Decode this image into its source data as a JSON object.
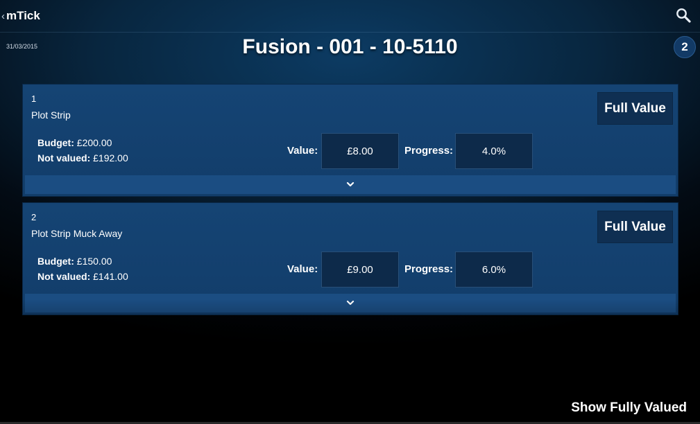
{
  "header": {
    "app_title": "mTick",
    "back_chevron": "‹",
    "date": "31/03/2015",
    "page_title": "Fusion - 001 - 10-5110",
    "badge_count": "2"
  },
  "items": [
    {
      "number": "1",
      "name": "Plot Strip",
      "budget_label": "Budget:",
      "budget_value": "£200.00",
      "not_valued_label": "Not valued:",
      "not_valued_value": "£192.00",
      "value_label": "Value:",
      "value": "£8.00",
      "progress_label": "Progress:",
      "progress": "4.0%",
      "full_value_label": "Full Value"
    },
    {
      "number": "2",
      "name": "Plot Strip Muck Away",
      "budget_label": "Budget:",
      "budget_value": "£150.00",
      "not_valued_label": "Not valued:",
      "not_valued_value": "£141.00",
      "value_label": "Value:",
      "value": "£9.00",
      "progress_label": "Progress:",
      "progress": "6.0%",
      "full_value_label": "Full Value"
    }
  ],
  "footer": {
    "show_fully_valued_label": "Show Fully Valued"
  },
  "icons": {
    "search": "search-icon",
    "expand": "chevron-down-icon"
  },
  "colors": {
    "card_background": "#154474",
    "expand_bar": "#1b4d82",
    "input_background": "#0d2a4a",
    "badge_background": "#123a66"
  }
}
